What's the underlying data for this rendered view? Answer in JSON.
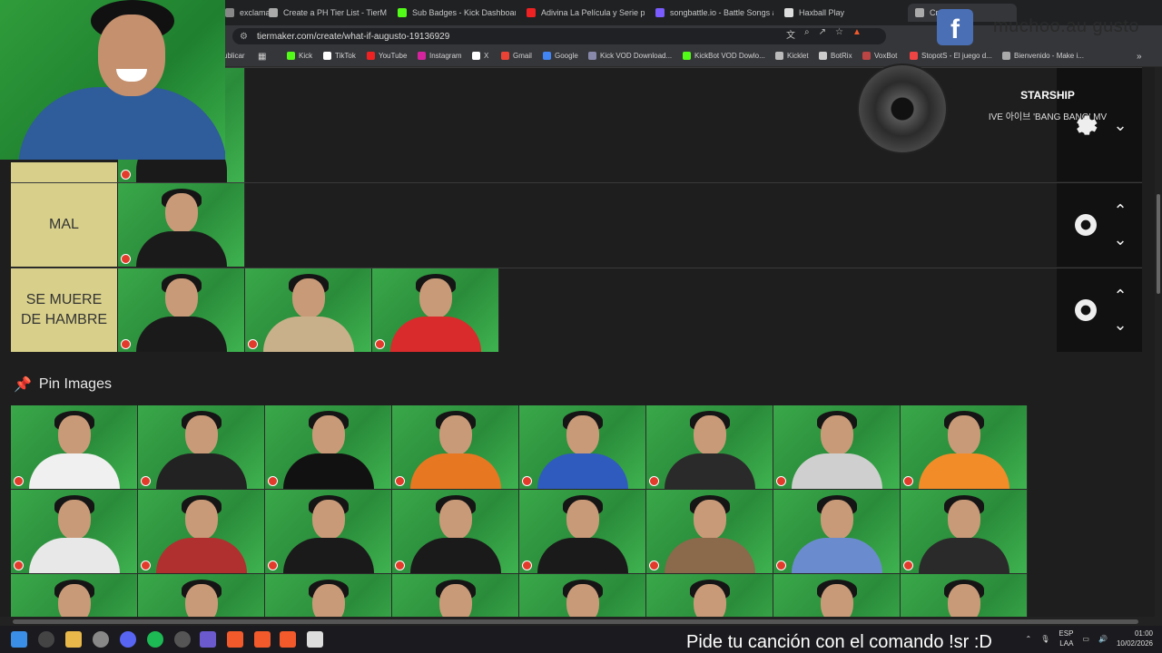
{
  "browser": {
    "tabs": [
      {
        "label": "exclama",
        "color": "#888"
      },
      {
        "label": "Create a PH Tier List - TierMak",
        "color": "#aaa"
      },
      {
        "label": "Sub Badges - Kick Dashboard",
        "color": "#53fc18"
      },
      {
        "label": "Adivina La Película y Serie por",
        "color": "#e22"
      },
      {
        "label": "songbattle.io - Battle Songs ag",
        "color": "#7a5cff"
      },
      {
        "label": "Haxball Play",
        "color": "#ddd"
      },
      {
        "label": "Cre",
        "color": "#aaa"
      }
    ],
    "url": "tiermaker.com/create/what-if-augusto-19136929",
    "bookmarks": [
      {
        "label": "ublicar",
        "color": "#777"
      },
      {
        "label": "Kick",
        "color": "#53fc18"
      },
      {
        "label": "TikTok",
        "color": "#fff"
      },
      {
        "label": "YouTube",
        "color": "#e22"
      },
      {
        "label": "Instagram",
        "color": "#d6249f"
      },
      {
        "label": "X",
        "color": "#fff"
      },
      {
        "label": "Gmail",
        "color": "#ea4335"
      },
      {
        "label": "Google",
        "color": "#4285f4"
      },
      {
        "label": "Kick VOD Download...",
        "color": "#88a"
      },
      {
        "label": "KickBot VOD Dowlo...",
        "color": "#53fc18"
      },
      {
        "label": "Kicklet",
        "color": "#bbb"
      },
      {
        "label": "BotRix",
        "color": "#ccc"
      },
      {
        "label": "VoxBot",
        "color": "#b44"
      },
      {
        "label": "StopotS - El juego d...",
        "color": "#e44"
      },
      {
        "label": "Bienvenido - Make i...",
        "color": "#aaa"
      }
    ]
  },
  "tiers": [
    {
      "label": "MAL",
      "images": [
        "#1a1a1a"
      ]
    },
    {
      "label": "SE MUERE DE HAMBRE",
      "images": [
        "#1a1a1a",
        "#c8b08a",
        "#d92b2b"
      ]
    }
  ],
  "pin_images": {
    "title": "Pin Images",
    "bodies": [
      "#f0f0f0",
      "#222222",
      "#111111",
      "#e87722",
      "#2f5bbf",
      "#2a2a2a",
      "#cfcfcf",
      "#f28c28",
      "#e8e8e8",
      "#b03030",
      "#1a1a1a",
      "#1a1a1a",
      "#1a1a1a",
      "#8a6a4a",
      "#6a8ccf",
      "#2a2a2a",
      "#f0f0f0",
      "#f0f0f0",
      "#f0c000",
      "#c09a60",
      "#2a2a2a",
      "#2a2a2a",
      "#3a3aa0",
      "#2a2a2a"
    ]
  },
  "overlay": {
    "social_handle": "muchoo.au gusto",
    "now_playing_title": "STARSHIP",
    "now_playing_subtitle": "IVE 아이브 'BANG BANG' MV"
  },
  "taskbar": {
    "ticker": "Pide tu canción con el comando !sr :D",
    "lang_1": "ESP",
    "lang_2": "LAA",
    "time": "01:00",
    "date": "10/02/2026"
  }
}
